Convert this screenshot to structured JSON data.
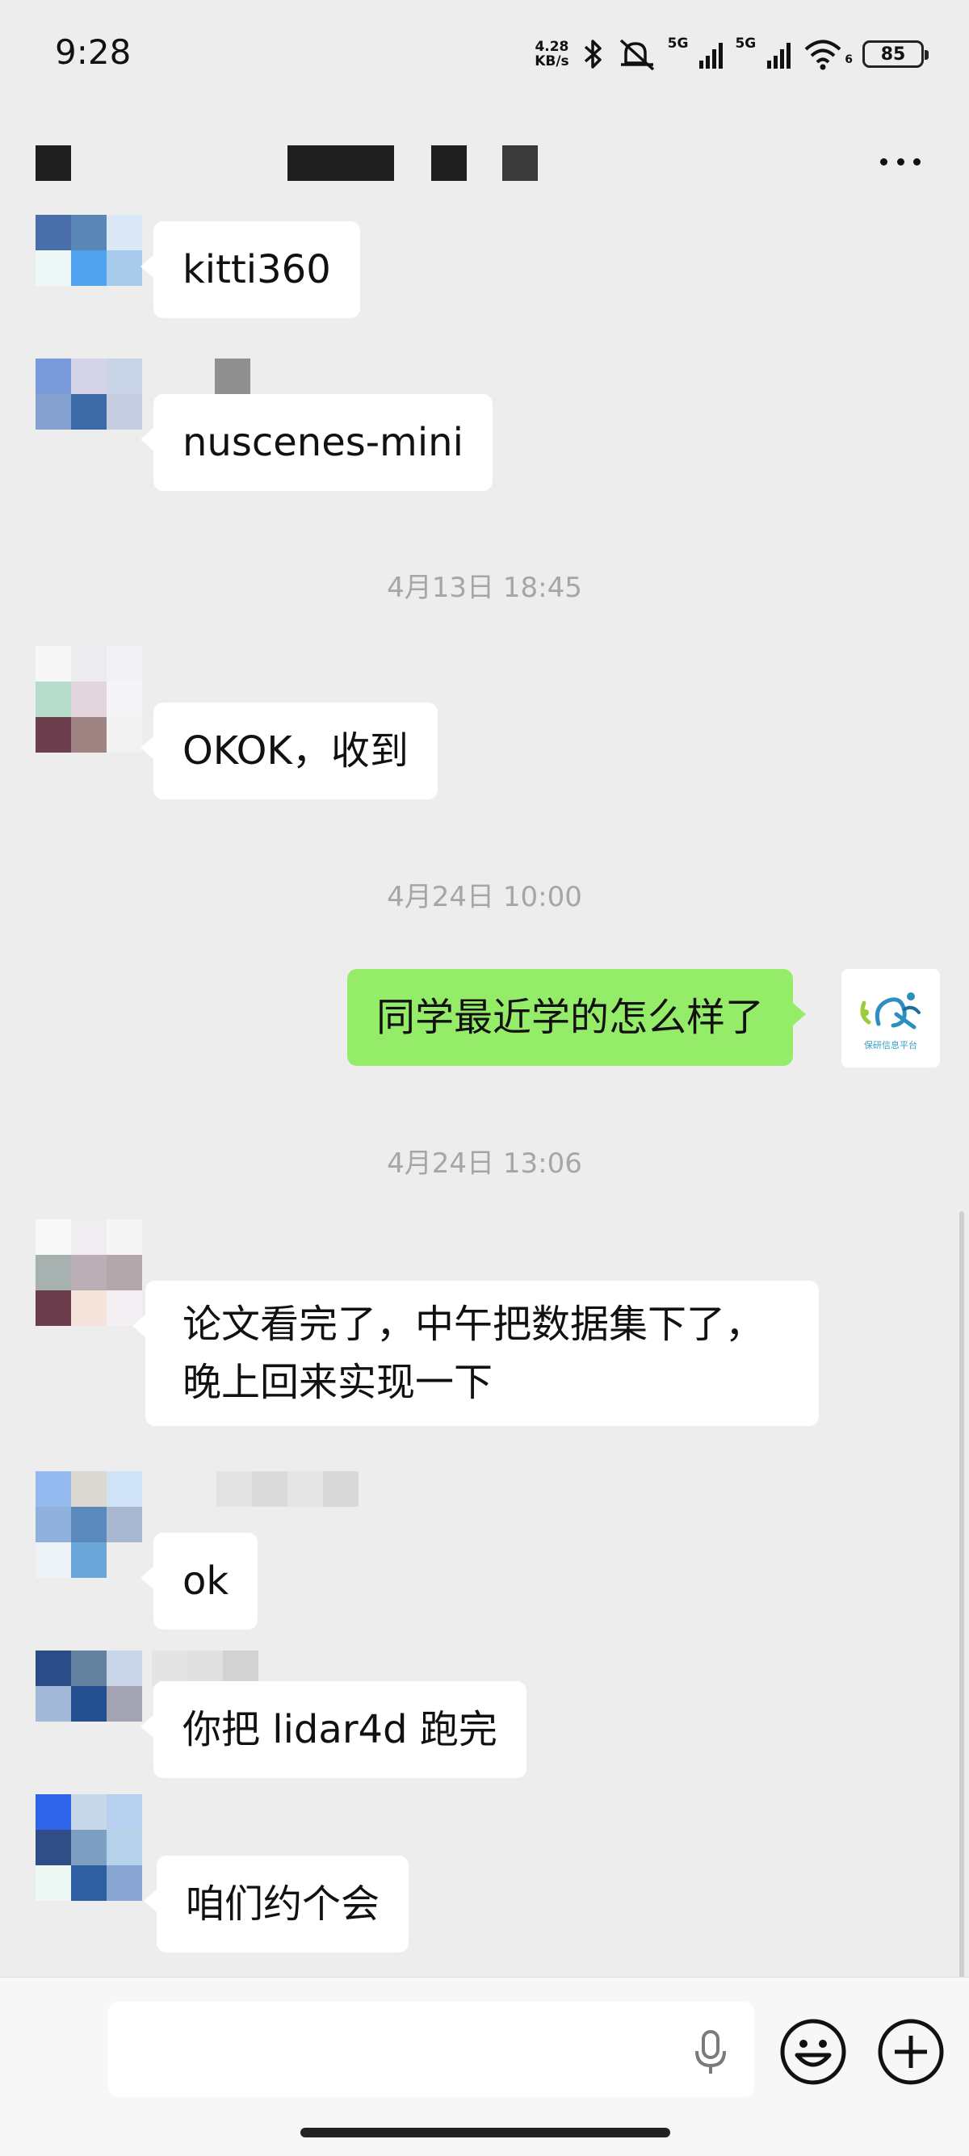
{
  "status_bar": {
    "time": "9:28",
    "net_speed_value": "4.28",
    "net_speed_unit": "KB/s",
    "network_1": "5G",
    "network_2": "5G",
    "wifi_sub": "6",
    "battery": "85",
    "icons": [
      "bluetooth-icon",
      "mute-icon",
      "signal-icon",
      "wifi-icon",
      "battery-icon"
    ]
  },
  "header": {
    "title": "",
    "more_icon": "more-dots-icon"
  },
  "messages": [
    {
      "side": "left",
      "text": "kitti360"
    },
    {
      "side": "left",
      "text": "nuscenes-mini"
    },
    {
      "type": "timestamp",
      "text": "4月13日 18:45"
    },
    {
      "side": "left",
      "text": "OKOK，收到"
    },
    {
      "type": "timestamp",
      "text": "4月24日 10:00"
    },
    {
      "side": "right",
      "text": "同学最近学的怎么样了",
      "avatar_caption": "保研信息平台"
    },
    {
      "type": "timestamp",
      "text": "4月24日 13:06"
    },
    {
      "side": "left",
      "text_line1": "论文看完了，中午把数据集下了，",
      "text_line2": "晚上回来实现一下"
    },
    {
      "side": "left",
      "text": "ok"
    },
    {
      "side": "left",
      "text": "你把 lidar4d 跑完"
    },
    {
      "side": "left",
      "text": "咱们约个会"
    }
  ],
  "input_bar": {
    "placeholder": "",
    "icons": [
      "microphone-icon",
      "emoji-icon",
      "plus-icon"
    ]
  },
  "colors": {
    "background": "#ededed",
    "bubble_self": "#95ec69",
    "bubble_other": "#ffffff",
    "timestamp": "#a6a6a6"
  }
}
